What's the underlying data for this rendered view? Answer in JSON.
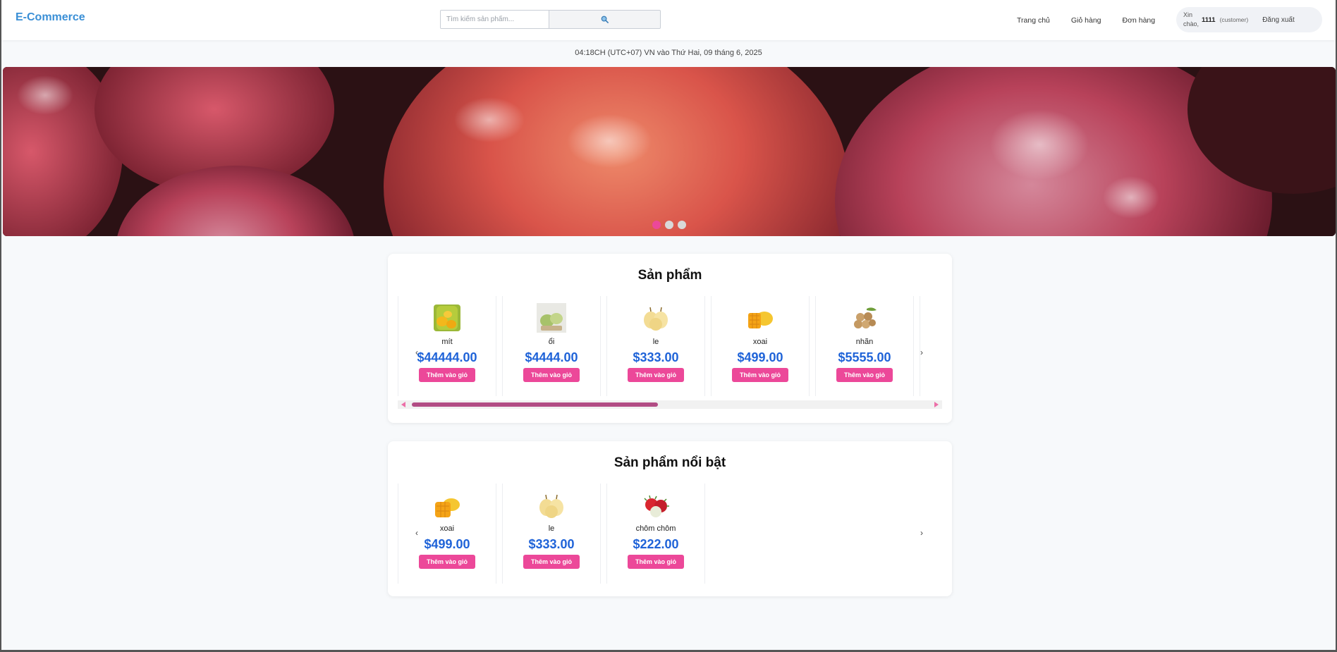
{
  "header": {
    "brand": "E-Commerce",
    "search_placeholder": "Tìm kiếm sản phẩm...",
    "search_icon": "magnifier-icon",
    "nav": [
      "Trang chủ",
      "Giỏ hàng",
      "Đơn hàng"
    ],
    "user": {
      "greeting": "Xin chào,",
      "name": "1111",
      "role": "(customer)",
      "logout": "Đăng xuất"
    }
  },
  "datetime": "04:18CH (UTC+07) VN vào Thứ Hai, 09 tháng 6, 2025",
  "banner": {
    "slides": 3,
    "active_slide": 1
  },
  "products": {
    "title": "Sản phẩm",
    "items": [
      {
        "name": "mít",
        "price": "$44444.00",
        "button": "Thêm vào giỏ",
        "icon": "jackfruit-icon"
      },
      {
        "name": "ổi",
        "price": "$4444.00",
        "button": "Thêm vào giỏ",
        "icon": "guava-icon"
      },
      {
        "name": "le",
        "price": "$333.00",
        "button": "Thêm vào giỏ",
        "icon": "pear-icon"
      },
      {
        "name": "xoai",
        "price": "$499.00",
        "button": "Thêm vào giỏ",
        "icon": "mango-icon"
      },
      {
        "name": "nhãn",
        "price": "$5555.00",
        "button": "Thêm vào giỏ",
        "icon": "longan-icon"
      }
    ]
  },
  "featured": {
    "title": "Sản phẩm nổi bật",
    "items": [
      {
        "name": "xoai",
        "price": "$499.00",
        "button": "Thêm vào giỏ",
        "icon": "mango-icon"
      },
      {
        "name": "le",
        "price": "$333.00",
        "button": "Thêm vào giỏ",
        "icon": "pear-icon"
      },
      {
        "name": "chôm chôm",
        "price": "$222.00",
        "button": "Thêm vào giỏ",
        "icon": "rambutan-icon"
      }
    ]
  },
  "colors": {
    "brand": "#3a8fd6",
    "accent": "#ec4899",
    "price": "#1f63d8"
  }
}
